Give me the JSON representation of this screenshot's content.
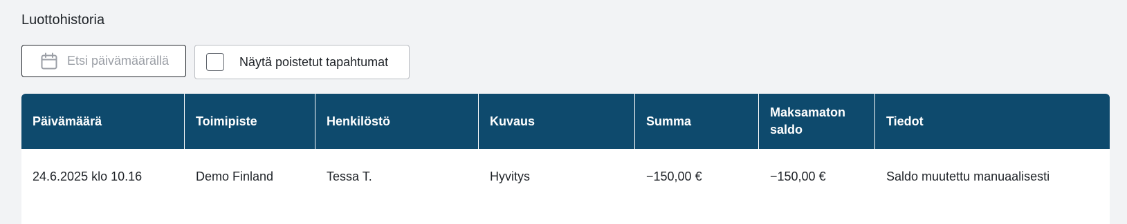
{
  "section": {
    "title": "Luottohistoria"
  },
  "filters": {
    "date_search_placeholder": "Etsi päivämäärällä",
    "date_search_icon": "calendar-icon",
    "show_deleted_label": "Näytä poistetut tapahtumat",
    "show_deleted_checked": false
  },
  "table": {
    "header_color": "#0e4a6d",
    "columns": [
      "Päivämäärä",
      "Toimipiste",
      "Henkilöstö",
      "Kuvaus",
      "Summa",
      "Maksamaton saldo",
      "Tiedot"
    ],
    "rows": [
      [
        "24.6.2025 klo 10.16",
        "Demo Finland",
        "Tessa T.",
        "Hyvitys",
        "−150,00 €",
        "−150,00 €",
        "Saldo muutettu manuaalisesti"
      ]
    ]
  }
}
